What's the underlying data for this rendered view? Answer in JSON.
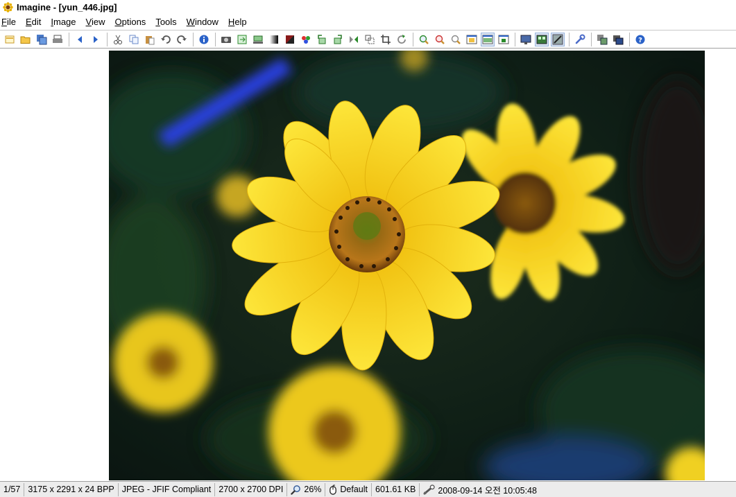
{
  "window": {
    "title": "Imagine - [yun_446.jpg]",
    "app_icon": "sunflower-icon"
  },
  "menu": [
    {
      "label": "File",
      "accel": "F",
      "rest": "ile"
    },
    {
      "label": "Edit",
      "accel": "E",
      "rest": "dit"
    },
    {
      "label": "Image",
      "accel": "I",
      "rest": "mage"
    },
    {
      "label": "View",
      "accel": "V",
      "rest": "iew"
    },
    {
      "label": "Options",
      "accel": "O",
      "rest": "ptions"
    },
    {
      "label": "Tools",
      "accel": "T",
      "rest": "ools"
    },
    {
      "label": "Window",
      "accel": "W",
      "rest": "indow"
    },
    {
      "label": "Help",
      "accel": "H",
      "rest": "elp"
    }
  ],
  "toolbar": {
    "icons": [
      "new-icon",
      "open-folder-icon",
      "save-all-icon",
      "print-icon",
      "previous-icon",
      "next-icon",
      "cut-icon",
      "copy-icon",
      "paste-icon",
      "undo-icon",
      "redo-icon",
      "info-icon",
      "capture-icon",
      "export-icon",
      "scan-icon",
      "gradient-icon",
      "gradient-dark-icon",
      "color-picker-icon",
      "rotate-left-icon",
      "rotate-right-icon",
      "flip-icon",
      "resize-icon",
      "crop-icon",
      "refresh-icon",
      "zoom-in-icon",
      "zoom-out-icon",
      "zoom-custom-icon",
      "fit-window-icon",
      "fit-width-icon",
      "actual-size-icon",
      "fullscreen-icon",
      "thumbnail-icon",
      "effects-icon",
      "settings-icon",
      "batch-icon",
      "slideshow-icon",
      "help-icon"
    ]
  },
  "image": {
    "filename": "yun_446.jpg",
    "background": "#0b1a12",
    "flower_color": "#f7d81e",
    "center_color": "#b5761a"
  },
  "statusbar": {
    "index": "1/57",
    "dimensions": "3175 x 2291 x 24 BPP",
    "format": "JPEG - JFIF Compliant",
    "dpi": "2700 x 2700 DPI",
    "zoom": "26%",
    "mouse_mode": "Default",
    "file_size": "601.61 KB",
    "datetime": "2008-09-14 오전 10:05:48"
  }
}
